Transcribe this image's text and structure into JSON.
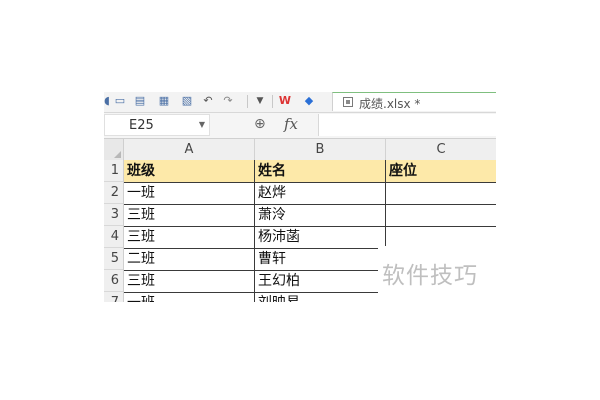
{
  "toolbar": {
    "icons": [
      "undo-icon",
      "redo-icon",
      "format-painter-icon",
      "dropdown-icon",
      "wps-logo-icon",
      "shield-icon",
      "new-window-icon",
      "print-icon",
      "preview-icon"
    ],
    "file_tab_label": "成绩.xlsx *"
  },
  "formula_bar": {
    "name_box": "E25",
    "fx_label": "fx",
    "formula": ""
  },
  "grid": {
    "columns": [
      "A",
      "B",
      "C"
    ],
    "rows": [
      "1",
      "2",
      "3",
      "4",
      "5",
      "6",
      "7"
    ],
    "header_row": [
      "班级",
      "姓名",
      "座位"
    ],
    "data": [
      [
        "一班",
        "赵烨",
        ""
      ],
      [
        "三班",
        "萧泠",
        ""
      ],
      [
        "三班",
        "杨沛菡",
        ""
      ],
      [
        "二班",
        "曹轩",
        ""
      ],
      [
        "三班",
        "王幻柏",
        ""
      ],
      [
        "一班",
        "刘映易",
        ""
      ]
    ]
  },
  "colors": {
    "header_fill": "#fde9a9",
    "grid_line": "#3a3a3a"
  },
  "watermark": "软件技巧"
}
